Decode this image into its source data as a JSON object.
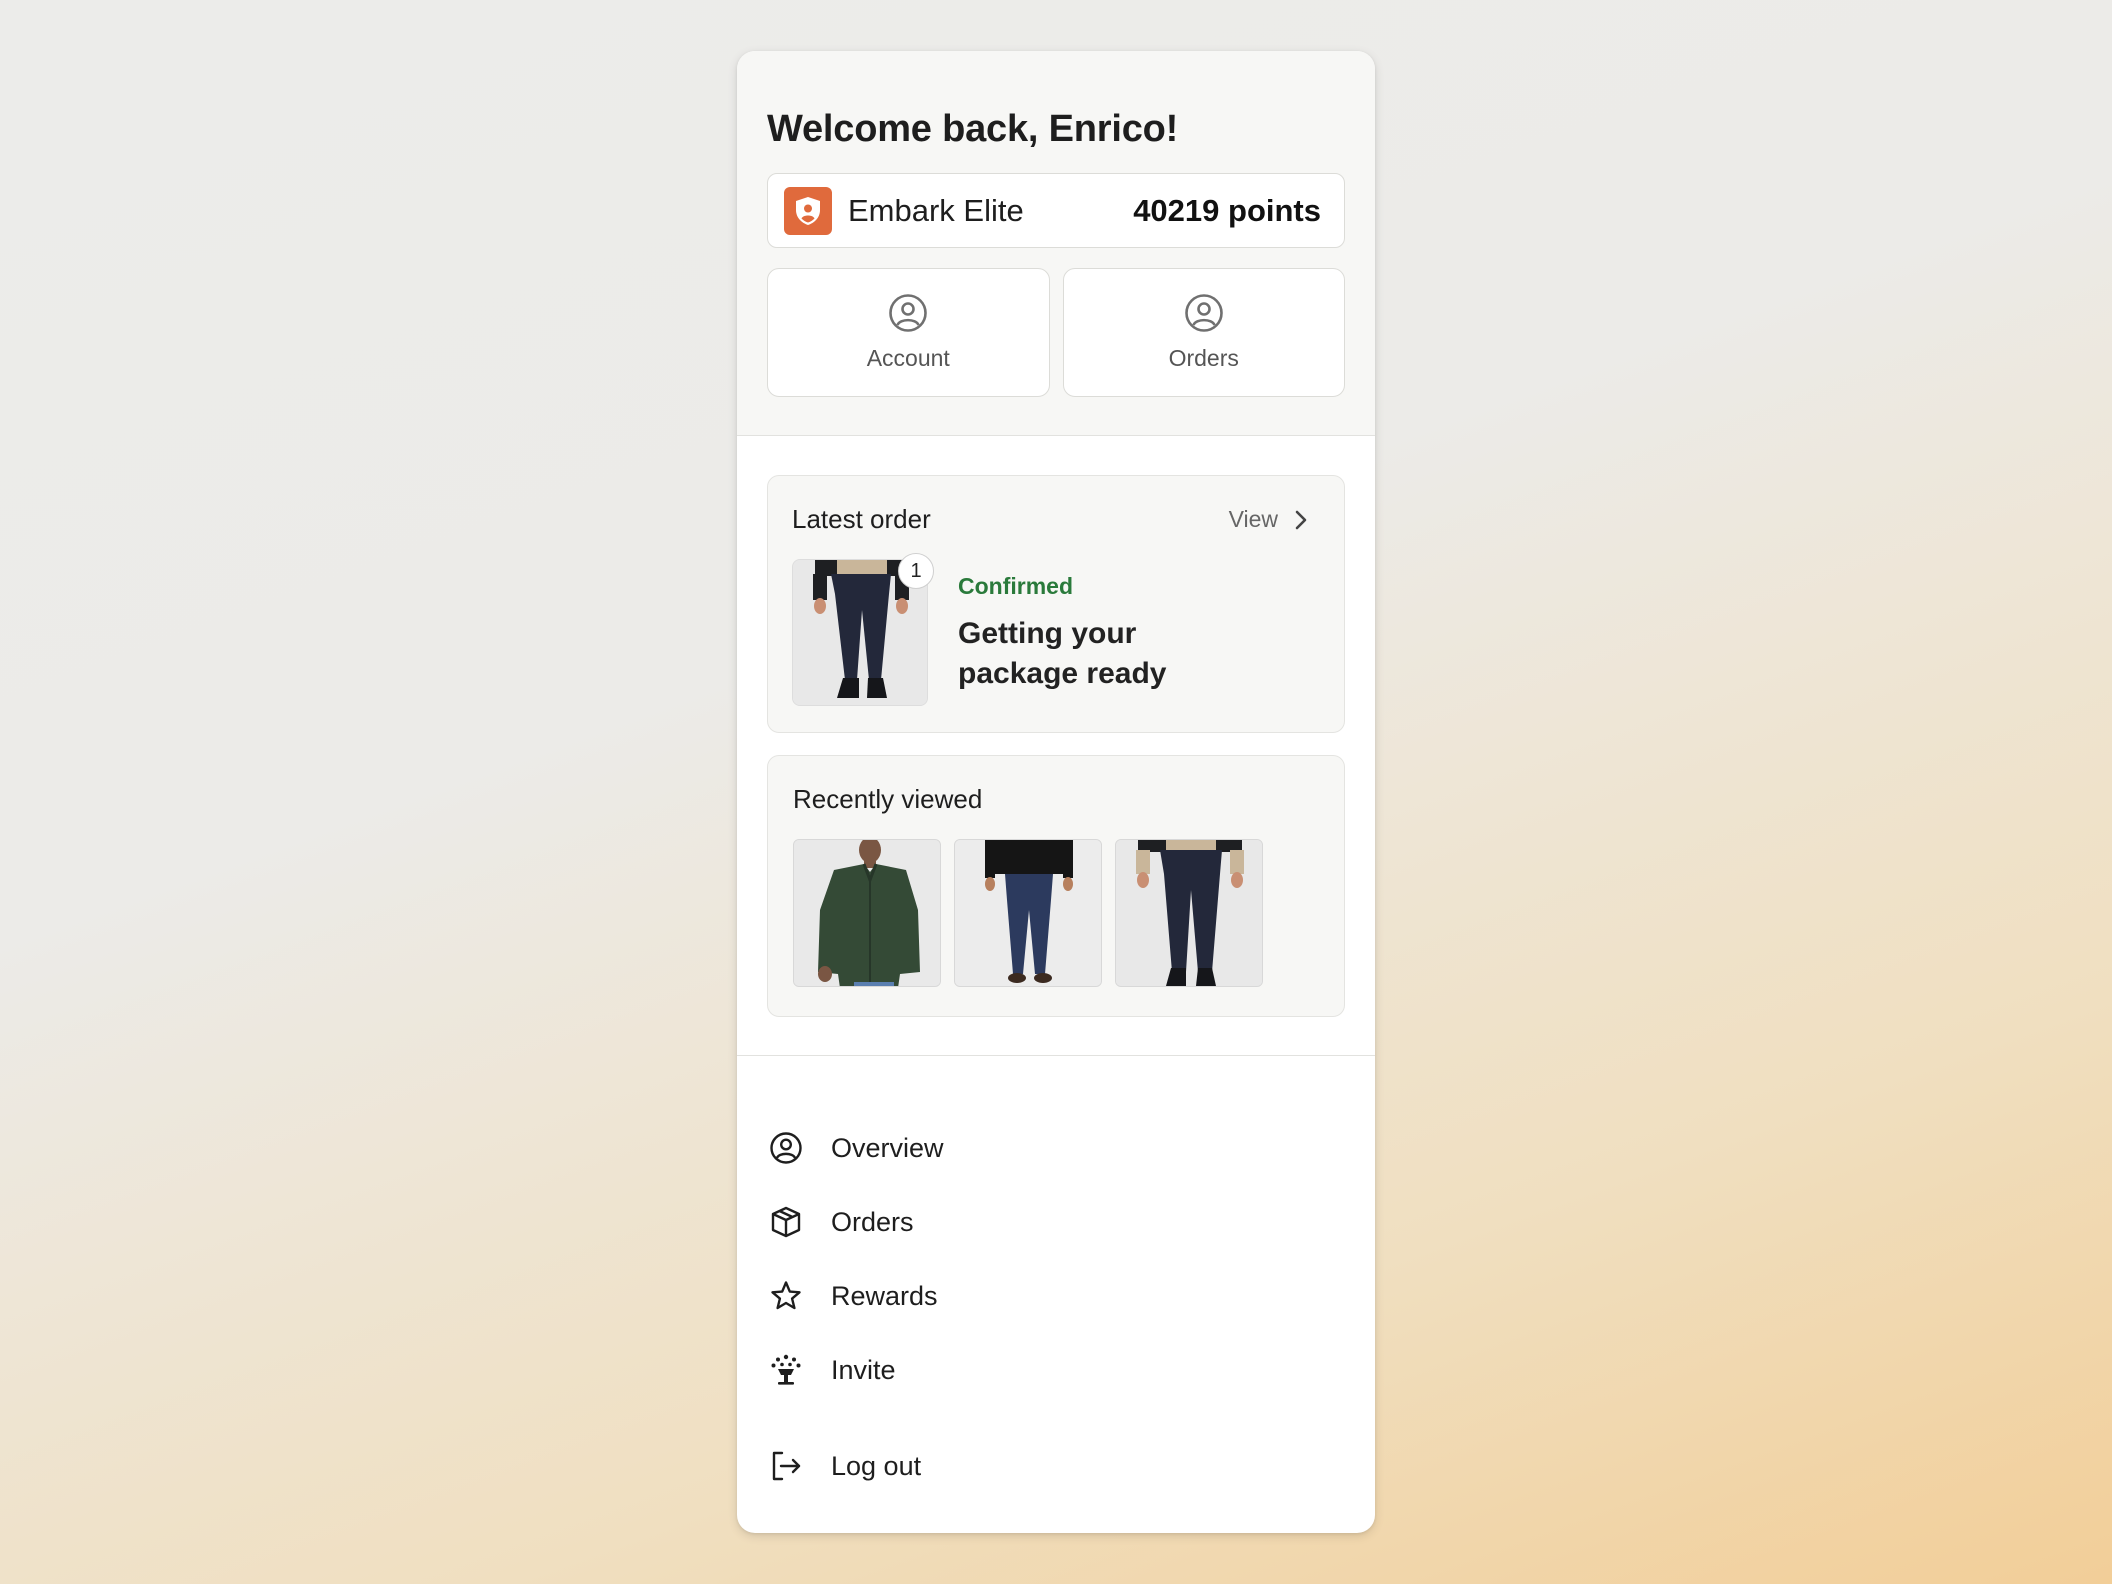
{
  "header": {
    "welcome": "Welcome back, Enrico!"
  },
  "tier": {
    "name": "Embark Elite",
    "points": "40219 points",
    "badge_icon": "shield-icon",
    "badge_color": "#e06a3c"
  },
  "quick_actions": [
    {
      "label": "Account",
      "icon": "user-circle-icon"
    },
    {
      "label": "Orders",
      "icon": "user-circle-icon"
    }
  ],
  "latest_order": {
    "title": "Latest order",
    "view_label": "View",
    "quantity": "1",
    "status": "Confirmed",
    "status_color": "#2a7a3b",
    "message": "Getting your package ready"
  },
  "recently_viewed": {
    "title": "Recently viewed"
  },
  "menu": {
    "items": [
      {
        "label": "Overview",
        "icon": "user-circle-icon"
      },
      {
        "label": "Orders",
        "icon": "box-icon"
      },
      {
        "label": "Rewards",
        "icon": "star-icon"
      },
      {
        "label": "Invite",
        "icon": "confetti-icon"
      }
    ],
    "logout": {
      "label": "Log out",
      "icon": "logout-icon"
    }
  }
}
